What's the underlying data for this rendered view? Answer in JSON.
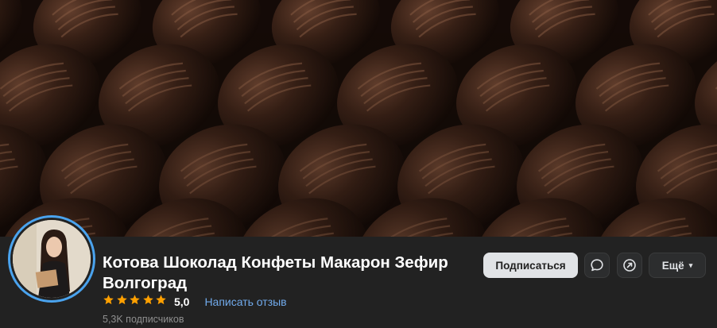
{
  "community": {
    "name": "Котова Шоколад Конфеты Макарон Зефир Волгоград",
    "rating_value": "5,0",
    "rating_stars": 5,
    "review_link": "Написать отзыв",
    "subscribers": "5,3K подписчиков"
  },
  "actions": {
    "subscribe_label": "Подписаться",
    "message_icon": "message-bubble-icon",
    "share_icon": "share-arrow-icon",
    "more_label": "Ещё"
  },
  "colors": {
    "accent": "#71aaeb",
    "avatar_ring": "#4aa3ee",
    "star": "#ffa000",
    "background": "#222222"
  }
}
